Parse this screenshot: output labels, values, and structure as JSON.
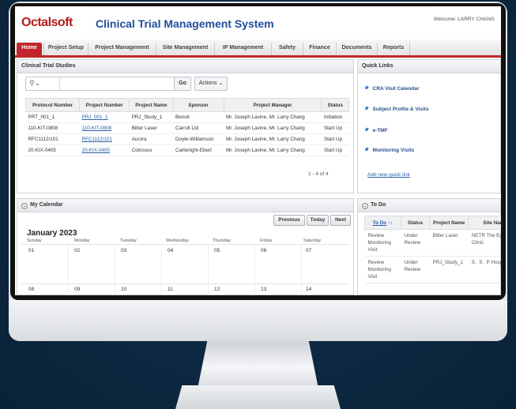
{
  "app": {
    "logo_text": "Octalsoft",
    "title": "Clinical Trial Management System",
    "welcome": "Welcome: LARRY CHANG"
  },
  "nav": [
    {
      "label": "Home",
      "active": true
    },
    {
      "label": "Project Setup"
    },
    {
      "label": "Project Management"
    },
    {
      "label": "Site Management"
    },
    {
      "label": "IP Management"
    },
    {
      "label": "Safety"
    },
    {
      "label": "Finance"
    },
    {
      "label": "Documents"
    },
    {
      "label": "Reports"
    }
  ],
  "studies": {
    "title": "Clinical Trial Studies",
    "go_label": "Go",
    "actions_label": "Actions",
    "columns": [
      "Protocol Number",
      "Project Number",
      "Project Name",
      "Sponsor",
      "Project Manager",
      "Status"
    ],
    "rows": [
      [
        "PRT_001_1",
        "PRJ_001_1",
        "PRJ_Study_1",
        "Benoit",
        "Mr. Joseph Lavine, Mr. Larry Chang",
        "Initiation"
      ],
      [
        "110-KIT-0808",
        "110-KIT-0808",
        "Bitter Laser",
        "Carroll Ltd",
        "Mr. Joseph Lavine, Mr. Larry Chang",
        "Start Up"
      ],
      [
        "RFC1112/101",
        "RFC1112/101",
        "Aurora",
        "Doyle-Williamson",
        "Mr. Joseph Lavine, Mr. Larry Chang",
        "Start Up"
      ],
      [
        "20-KIX-0405",
        "20-KIX-0405",
        "Colossus",
        "Cartwright-Ebert",
        "Mr. Joseph Lavine, Mr. Larry Chang",
        "Start Up"
      ]
    ],
    "pager": "1 - 4 of 4"
  },
  "quick_links": {
    "title": "Quick Links",
    "items": [
      "CRA Visit Calendar",
      "Subject Profile & Visits",
      "e-TMF",
      "Monitoring Visits"
    ],
    "add_label": "Add new quick link"
  },
  "calendar": {
    "title": "My Calendar",
    "prev_label": "Previous",
    "today_label": "Today",
    "next_label": "Next",
    "month": "January 2023",
    "weekdays": [
      "Sunday",
      "Monday",
      "Tuesday",
      "Wednesday",
      "Thursday",
      "Friday",
      "Saturday"
    ],
    "week1": [
      "01",
      "02",
      "03",
      "04",
      "05",
      "06",
      "07"
    ],
    "week2": [
      "08",
      "09",
      "10",
      "11",
      "12",
      "13",
      "14"
    ]
  },
  "todo": {
    "title": "To Do",
    "columns": [
      "To Do",
      "Status",
      "Project Name",
      "Site Name"
    ],
    "sort_indicator": "↑↓",
    "rows": [
      [
        "Review Monitoring Visit",
        "Under Review",
        "Bitter Laser",
        "NETR The Eyecare Clinic"
      ],
      [
        "Review Monitoring Visit",
        "Under Review",
        "PRJ_Study_1",
        "S . S . P Hospital"
      ]
    ]
  },
  "colors": {
    "brand_red": "#c0262c",
    "title_blue": "#1f4e9b",
    "link_blue": "#2a5ea8",
    "backdrop": "#0f2e4a"
  }
}
